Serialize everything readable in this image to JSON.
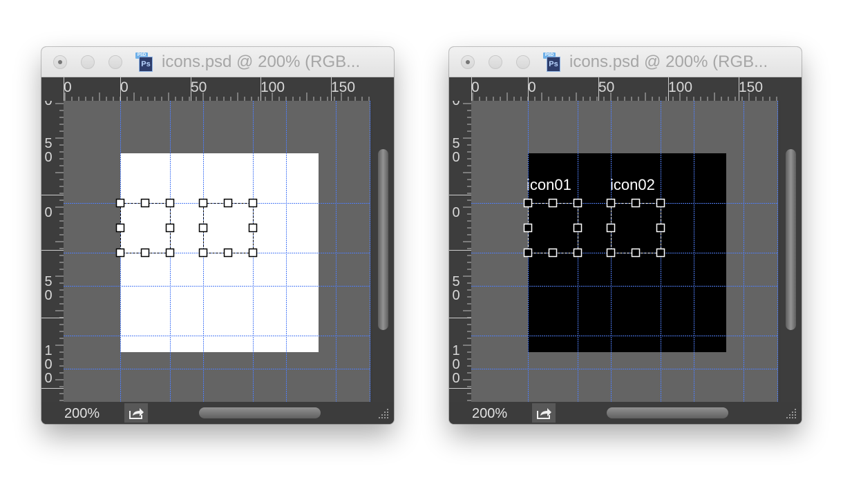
{
  "windows": [
    {
      "title": "icons.psd @ 200% (RGB...",
      "file_badge": "PSD",
      "app_badge": "Ps",
      "zoom": "200%",
      "ruler": {
        "h_labels": [
          "0",
          "0",
          "50",
          "100",
          "150"
        ],
        "v_labels": [
          "0",
          "50",
          "0",
          "50",
          "100"
        ]
      },
      "document_background": "#ffffff",
      "icon_labels": []
    },
    {
      "title": "icons.psd @ 200% (RGB...",
      "file_badge": "PSD",
      "app_badge": "Ps",
      "zoom": "200%",
      "ruler": {
        "h_labels": [
          "0",
          "0",
          "50",
          "100",
          "150"
        ],
        "v_labels": [
          "0",
          "50",
          "0",
          "50",
          "100"
        ]
      },
      "document_background": "#000000",
      "icon_labels": [
        "icon01",
        "icon02"
      ]
    }
  ],
  "colors": {
    "guide": "#4f7df5",
    "pasteboard": "#646464",
    "chrome": "#3c3c3c"
  },
  "icons": {
    "share": "share-icon",
    "resize": "resize-grip-icon"
  }
}
